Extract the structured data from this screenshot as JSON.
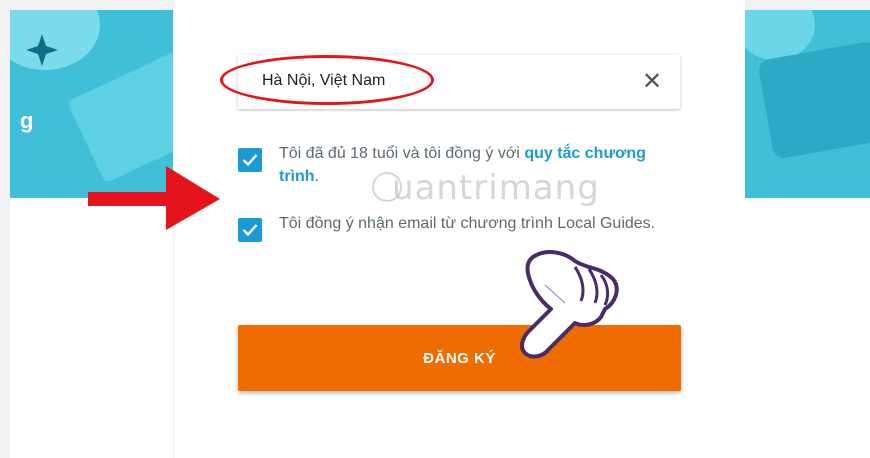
{
  "background": {
    "left_partial_letter": "g"
  },
  "form": {
    "location_value": "Hà Nội, Việt Nam",
    "clear_icon": "close-icon",
    "age_checkbox": {
      "checked": true,
      "text_before": "Tôi đã đủ 18 tuổi và tôi đồng ý với ",
      "link_text": "quy tắc chương trình",
      "text_after": "."
    },
    "email_checkbox": {
      "checked": true,
      "text": "Tôi đồng ý nhận email từ chương trình Local Guides."
    },
    "submit_label": "ĐĂNG KÝ"
  },
  "overlay": {
    "watermark": "uantrimang"
  },
  "colors": {
    "accent": "#1a9ad6",
    "button": "#ee6c00",
    "annotation": "#e5141c",
    "banner": "#3fc0d8"
  }
}
